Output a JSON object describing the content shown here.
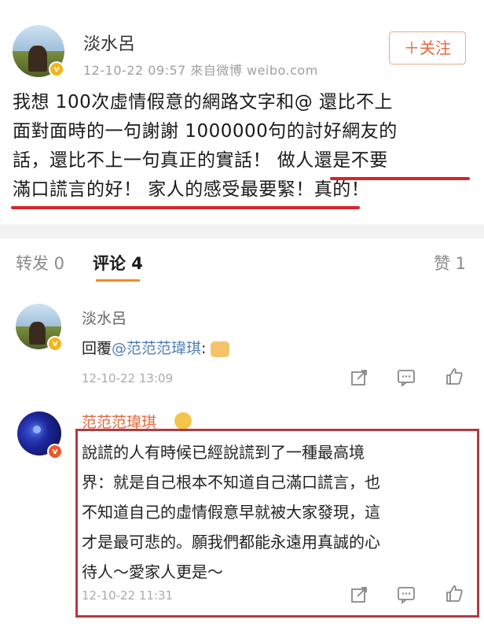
{
  "post": {
    "author": "淡水呂",
    "meta": "12-10-22 09:57  來自微博 weibo.com",
    "follow_label": "＋关注",
    "lines": [
      "我想 100次虛情假意的網路文字和@ 還比不上",
      "面對面時的一句謝謝 1000000句的討好網友的",
      "話，還比不上一句真正的實話！ 做人還是不要",
      "滿口謊言的好！ 家人的感受最要緊！真的！"
    ]
  },
  "tabs": {
    "repost": "转发 0",
    "comments": "评论 4",
    "likes": "赞 1"
  },
  "comments": [
    {
      "author": "淡水呂",
      "reply_prefix": "回覆",
      "mention": "@范范范瑋琪",
      "after_mention": ":",
      "time": "12-10-22 13:09"
    },
    {
      "author": "范范范瑋琪",
      "lines": [
        "說謊的人有時候已經說謊到了一種最高境",
        "界：就是自己根本不知道自己滿口謊言，也",
        "不知道自己的虛情假意早就被大家發現，這",
        "才是最可悲的。願我們都能永遠用真誠的心",
        "待人～愛家人更是～"
      ],
      "time": "12-10-22 11:31"
    }
  ],
  "colors": {
    "accent_orange": "#e8673c",
    "link_blue": "#4f7fb8",
    "highlight_red": "#d8242a",
    "badge_gold": "#f4b41a"
  }
}
